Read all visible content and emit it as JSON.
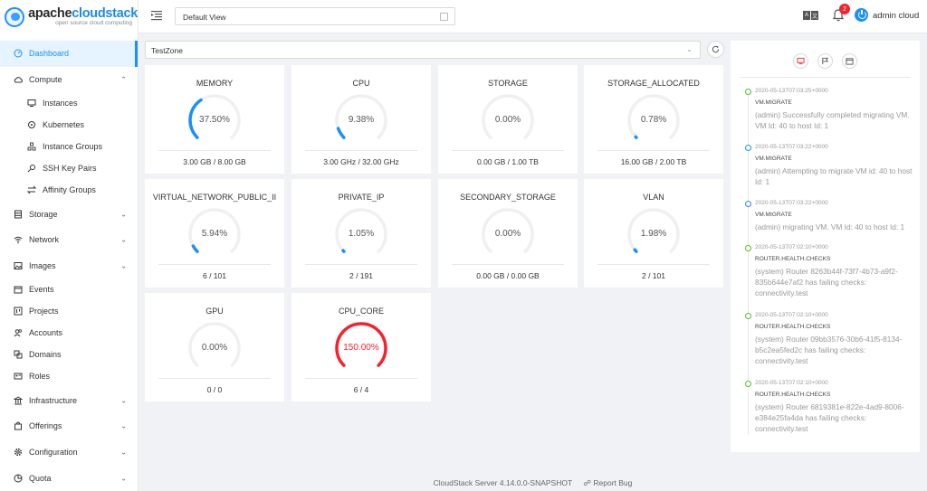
{
  "logo": {
    "brand_a": "apache",
    "brand_b": "cloudstack",
    "tagline": "open source cloud computing"
  },
  "sidebar": {
    "items": [
      {
        "label": "Dashboard",
        "icon": "dashboard-icon",
        "active": true,
        "level": "top"
      },
      {
        "label": "Compute",
        "icon": "cloud-icon",
        "level": "top",
        "expanded": true
      },
      {
        "label": "Instances",
        "icon": "desktop-icon",
        "level": "sub"
      },
      {
        "label": "Kubernetes",
        "icon": "kubernetes-icon",
        "level": "sub"
      },
      {
        "label": "Instance Groups",
        "icon": "cluster-icon",
        "level": "sub"
      },
      {
        "label": "SSH Key Pairs",
        "icon": "key-icon",
        "level": "sub"
      },
      {
        "label": "Affinity Groups",
        "icon": "swap-icon",
        "level": "sub"
      },
      {
        "label": "Storage",
        "icon": "database-icon",
        "level": "top",
        "expandable": true
      },
      {
        "label": "Network",
        "icon": "wifi-icon",
        "level": "top",
        "expandable": true
      },
      {
        "label": "Images",
        "icon": "picture-icon",
        "level": "top",
        "expandable": true
      },
      {
        "label": "Events",
        "icon": "schedule-icon",
        "level": "sub"
      },
      {
        "label": "Projects",
        "icon": "project-icon",
        "level": "sub"
      },
      {
        "label": "Accounts",
        "icon": "team-icon",
        "level": "sub"
      },
      {
        "label": "Domains",
        "icon": "block-icon",
        "level": "sub"
      },
      {
        "label": "Roles",
        "icon": "idcard-icon",
        "level": "sub"
      },
      {
        "label": "Infrastructure",
        "icon": "bank-icon",
        "level": "top",
        "expandable": true
      },
      {
        "label": "Offerings",
        "icon": "shopping-icon",
        "level": "top",
        "expandable": true
      },
      {
        "label": "Configuration",
        "icon": "setting-icon",
        "level": "top",
        "expandable": true
      },
      {
        "label": "Quota",
        "icon": "pie-chart-icon",
        "level": "top",
        "expandable": true
      }
    ]
  },
  "header": {
    "view_select": "Default View",
    "notification_count": "2",
    "lang_a": "A",
    "lang_b": "文",
    "user": "admin cloud"
  },
  "zone": {
    "selected": "TestZone"
  },
  "cards": [
    {
      "title": "MEMORY",
      "pct": "37.50%",
      "value": 0.375,
      "detail": "3.00 GB / 8.00 GB",
      "color": "#1890ff"
    },
    {
      "title": "CPU",
      "pct": "9.38%",
      "value": 0.0938,
      "detail": "3.00 GHz / 32.00 GHz",
      "color": "#1890ff"
    },
    {
      "title": "STORAGE",
      "pct": "0.00%",
      "value": 0,
      "detail": "0.00 GB / 1.00 TB",
      "color": "#1890ff"
    },
    {
      "title": "STORAGE_ALLOCATED",
      "pct": "0.78%",
      "value": 0.0078,
      "detail": "16.00 GB / 2.00 TB",
      "color": "#1890ff"
    },
    {
      "title": "VIRTUAL_NETWORK_PUBLIC_II",
      "pct": "5.94%",
      "value": 0.0594,
      "detail": "6 / 101",
      "color": "#1890ff"
    },
    {
      "title": "PRIVATE_IP",
      "pct": "1.05%",
      "value": 0.0105,
      "detail": "2 / 191",
      "color": "#1890ff"
    },
    {
      "title": "SECONDARY_STORAGE",
      "pct": "0.00%",
      "value": 0,
      "detail": "0.00 GB / 0.00 GB",
      "color": "#1890ff"
    },
    {
      "title": "VLAN",
      "pct": "1.98%",
      "value": 0.0198,
      "detail": "2 / 101",
      "color": "#1890ff"
    },
    {
      "title": "GPU",
      "pct": "0.00%",
      "value": 0,
      "detail": "0 / 0",
      "color": "#1890ff"
    },
    {
      "title": "CPU_CORE",
      "pct": "150.00%",
      "value": 1.0,
      "detail": "6 / 4",
      "color": "#f5222d"
    }
  ],
  "events": [
    {
      "ts": "2020-05-13T07:03:25+0000",
      "type": "VM.MIGRATE",
      "desc": "(admin) Successfully completed migrating VM. VM Id: 40 to host Id: 1",
      "status": "green"
    },
    {
      "ts": "2020-05-13T07:03:22+0000",
      "type": "VM.MIGRATE",
      "desc": "(admin) Attempting to migrate VM id: 40 to host Id: 1",
      "status": "blue"
    },
    {
      "ts": "2020-05-13T07:03:22+0000",
      "type": "VM.MIGRATE",
      "desc": "(admin) migrating VM. VM Id: 40 to host Id: 1",
      "status": "blue"
    },
    {
      "ts": "2020-05-13T07:02:10+0000",
      "type": "ROUTER.HEALTH.CHECKS",
      "desc": "(system) Router 8263b44f-73f7-4b73-a9f2-835b644e7af2 has failing checks: connectivity.test",
      "status": "green"
    },
    {
      "ts": "2020-05-13T07:02:10+0000",
      "type": "ROUTER.HEALTH.CHECKS",
      "desc": "(system) Router 09bb3576-30b6-41f5-8134-b5c2ea5fed2c has failing checks: connectivity.test",
      "status": "green"
    },
    {
      "ts": "2020-05-13T07:02:10+0000",
      "type": "ROUTER.HEALTH.CHECKS",
      "desc": "(system) Router 6819381e-822e-4ad9-8006-e384e25fa4da has failing checks: connectivity.test",
      "status": "green"
    }
  ],
  "footer": {
    "version": "CloudStack Server 4.14.0.0-SNAPSHOT",
    "report": "Report Bug"
  }
}
